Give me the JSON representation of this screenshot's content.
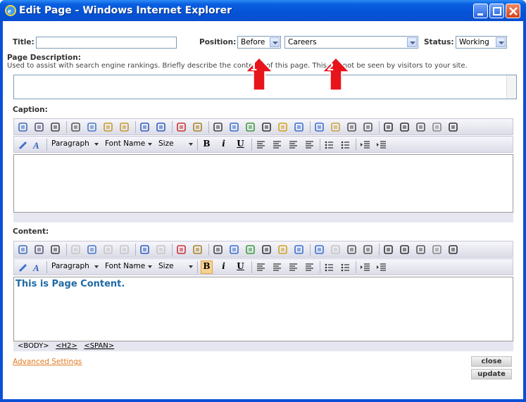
{
  "window": {
    "title": "Edit Page - Windows Internet Explorer"
  },
  "form": {
    "title_label": "Title:",
    "title_value": "",
    "position_label": "Position:",
    "position_value": "Before",
    "page_value": "Careers",
    "status_label": "Status:",
    "status_value": "Working",
    "description_label": "Page Description:",
    "description_help": "Used to assist with search engine rankings. Briefly describe the contents of this page. This will not be seen by visitors to your site.",
    "caption_label": "Caption:",
    "content_label": "Content:"
  },
  "toolbar": {
    "paragraph": "Paragraph",
    "font_name": "Font Name",
    "size": "Size",
    "bold": "B",
    "italic": "i",
    "underline": "U"
  },
  "content_editor": {
    "text": "This is Page Content.",
    "path": [
      "<BODY>",
      "<H2>",
      "<SPAN>"
    ]
  },
  "footer": {
    "advanced_link": "Advanced Settings",
    "close_label": "close",
    "update_label": "update"
  },
  "annotations": {
    "marker_1": "1",
    "marker_2": "2"
  },
  "colors": {
    "accent_link": "#e07a1f",
    "content_text": "#1f6aa5",
    "annotation_red": "#e8141c"
  }
}
